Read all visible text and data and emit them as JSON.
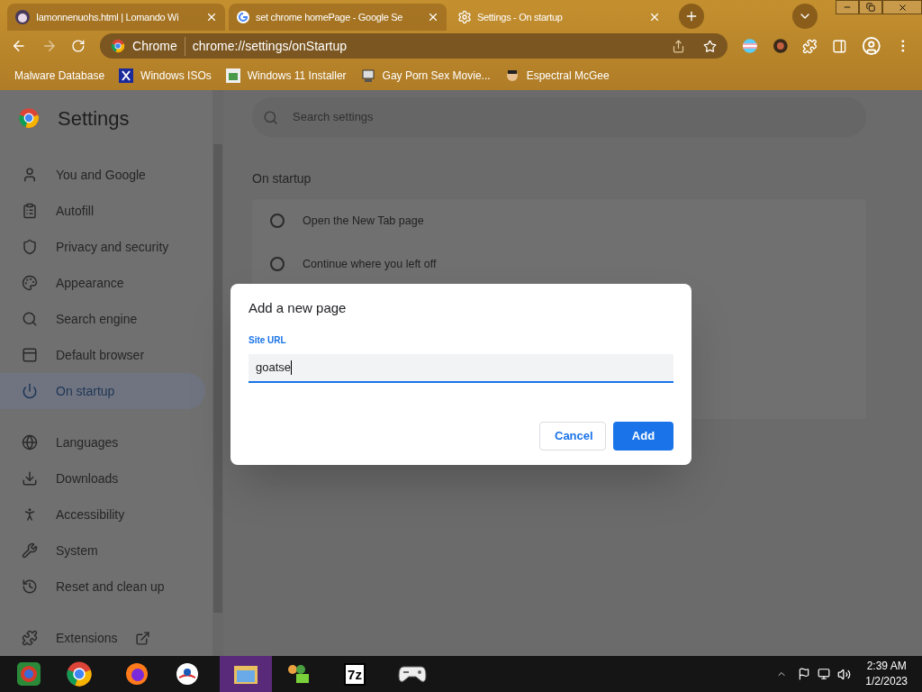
{
  "tabs": [
    {
      "title": "Iamonnenuohs.html | Lomando Wi",
      "selected": false
    },
    {
      "title": "set chrome homePage - Google Se",
      "selected": false
    },
    {
      "title": "Settings - On startup",
      "selected": true
    }
  ],
  "toolbar": {
    "chip": "Chrome",
    "url": "chrome://settings/onStartup"
  },
  "bookmarks": [
    "Malware Database",
    "Windows ISOs",
    "Windows 11 Installer",
    "Gay Porn Sex Movie...",
    "Espectral McGee"
  ],
  "settings": {
    "title": "Settings",
    "search_placeholder": "Search settings",
    "nav": [
      {
        "label": "You and Google",
        "selected": false
      },
      {
        "label": "Autofill",
        "selected": false
      },
      {
        "label": "Privacy and security",
        "selected": false
      },
      {
        "label": "Appearance",
        "selected": false
      },
      {
        "label": "Search engine",
        "selected": false
      },
      {
        "label": "Default browser",
        "selected": false
      },
      {
        "label": "On startup",
        "selected": true
      }
    ],
    "nav_more": [
      {
        "label": "Languages",
        "selected": false
      },
      {
        "label": "Downloads",
        "selected": false
      },
      {
        "label": "Accessibility",
        "selected": false
      },
      {
        "label": "System",
        "selected": false
      },
      {
        "label": "Reset and clean up",
        "selected": false
      }
    ],
    "extensions": "Extensions",
    "section_title": "On startup",
    "options": [
      {
        "label": "Open the New Tab page",
        "selected": false
      },
      {
        "label": "Continue where you left off",
        "selected": false
      }
    ]
  },
  "dialog": {
    "title": "Add a new page",
    "field_label": "Site URL",
    "value": "goatse",
    "buttons": [
      {
        "label": "Cancel",
        "kind": "secondary"
      },
      {
        "label": "Add",
        "kind": "primary"
      }
    ]
  },
  "taskbar": {
    "logo_7z": "7z",
    "time": "2:39 AM",
    "date": "1/2/2023"
  }
}
